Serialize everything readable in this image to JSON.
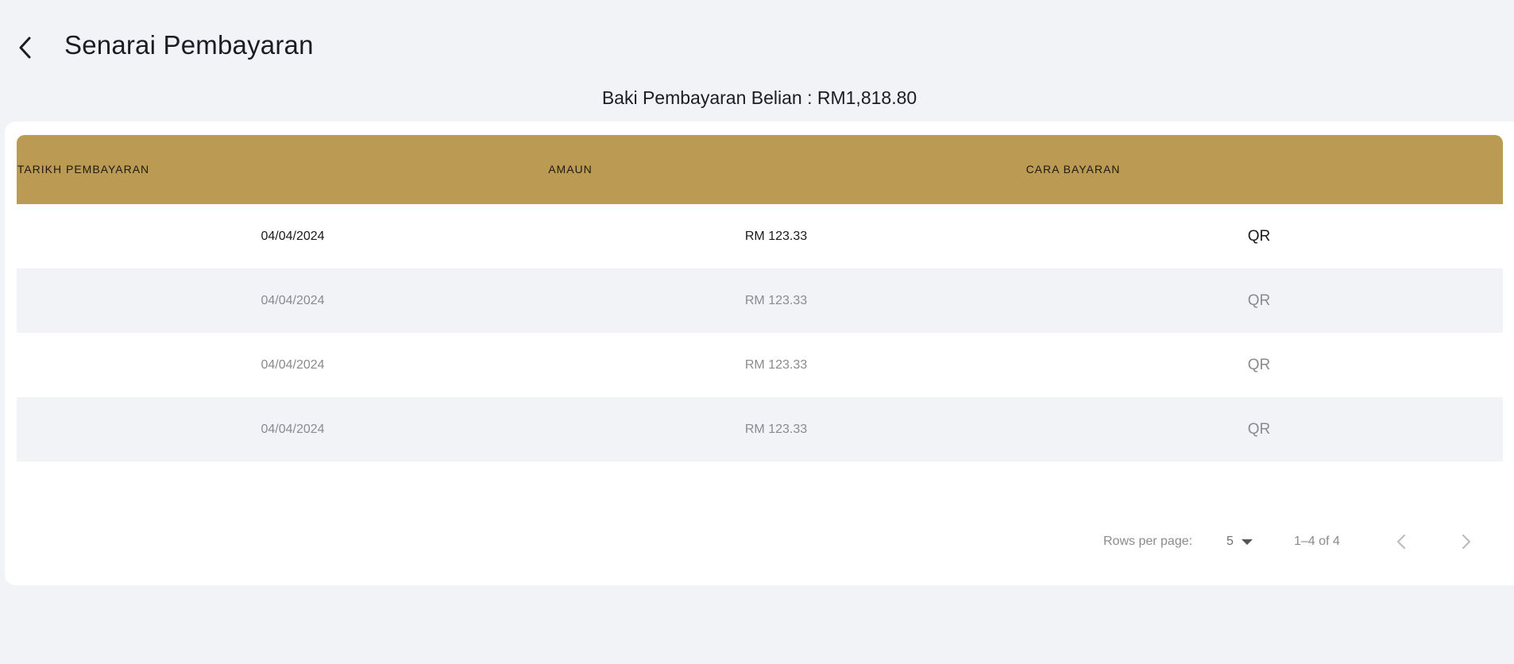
{
  "header": {
    "back_icon": "chevron-left-icon",
    "title": "Senarai Pembayaran"
  },
  "balance": {
    "text": "Baki Pembayaran Belian : RM1,818.80"
  },
  "table": {
    "header_color": "#bb9a53",
    "columns": {
      "date": "TARIKH PEMBAYARAN",
      "amount": "AMAUN",
      "method": "CARA BAYARAN"
    },
    "rows": [
      {
        "date": "04/04/2024",
        "amount": "RM 123.33",
        "method": "QR"
      },
      {
        "date": "04/04/2024",
        "amount": "RM 123.33",
        "method": "QR"
      },
      {
        "date": "04/04/2024",
        "amount": "RM 123.33",
        "method": "QR"
      },
      {
        "date": "04/04/2024",
        "amount": "RM 123.33",
        "method": "QR"
      }
    ]
  },
  "pagination": {
    "rows_per_page_label": "Rows per page:",
    "rows_per_page_value": "5",
    "range_text": "1–4 of 4",
    "prev_icon": "chevron-left-icon",
    "next_icon": "chevron-right-icon"
  }
}
